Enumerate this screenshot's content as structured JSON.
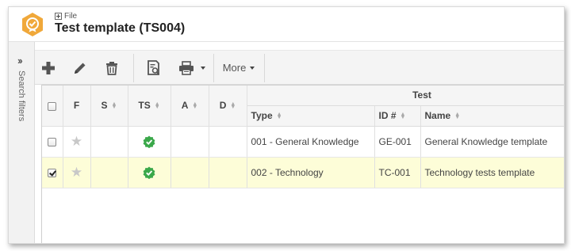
{
  "breadcrumb": {
    "label": "File"
  },
  "page": {
    "title": "Test template (TS004)"
  },
  "sidebar": {
    "label": "Search filters"
  },
  "toolbar": {
    "add_icon": "plus-icon",
    "edit_icon": "pencil-icon",
    "delete_icon": "trash-icon",
    "view_icon": "document-search-icon",
    "print_icon": "printer-icon",
    "more_label": "More"
  },
  "colors": {
    "accent": "#f0a83a",
    "verified": "#3aa84a",
    "selected_row": "#fdfdd8"
  },
  "table": {
    "group_header": "Test",
    "columns": {
      "f": "F",
      "s": "S",
      "ts": "TS",
      "a": "A",
      "d": "D",
      "type": "Type",
      "id": "ID #",
      "name": "Name"
    },
    "rows": [
      {
        "checked": false,
        "type": "001 - General Knowledge",
        "id": "GE-001",
        "name": "General Knowledge template"
      },
      {
        "checked": true,
        "type": "002 - Technology",
        "id": "TC-001",
        "name": "Technology tests template"
      }
    ]
  }
}
